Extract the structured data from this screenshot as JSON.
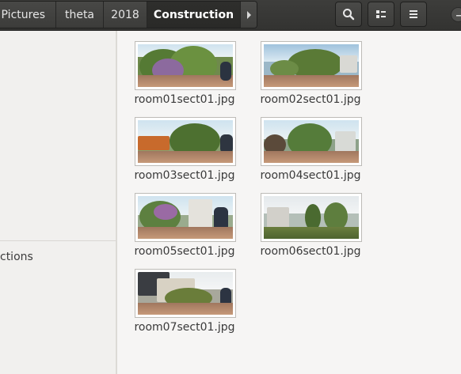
{
  "breadcrumb": {
    "items": [
      "Pictures",
      "theta",
      "2018"
    ],
    "current": "Construction"
  },
  "header_icons": {
    "search": "search-icon",
    "view": "view-toggle-icon",
    "menu": "hamburger-menu-icon",
    "window": "window-control-icon"
  },
  "sidebar": {
    "item_partial": "ctions"
  },
  "files": [
    {
      "name": "room01sect01.jpg"
    },
    {
      "name": "room02sect01.jpg"
    },
    {
      "name": "room03sect01.jpg"
    },
    {
      "name": "room04sect01.jpg"
    },
    {
      "name": "room05sect01.jpg"
    },
    {
      "name": "room06sect01.jpg"
    },
    {
      "name": "room07sect01.jpg"
    }
  ],
  "colors": {
    "headerbar": "#363634",
    "content_bg": "#f6f5f4",
    "sidebar_bg": "#f1f0ee"
  }
}
